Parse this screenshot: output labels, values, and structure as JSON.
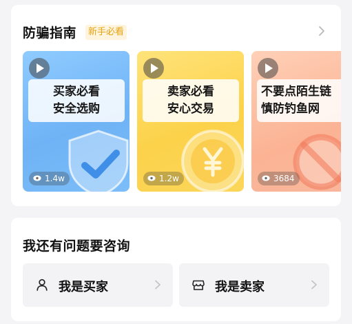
{
  "guide": {
    "title": "防骗指南",
    "badge": "新手必看",
    "chevron_icon": "chevron-right-icon",
    "videos": [
      {
        "lines": [
          "买家必看",
          "安全选购"
        ],
        "views": "1.4w",
        "theme": "blue",
        "art": "shield-check-icon"
      },
      {
        "lines": [
          "卖家必看",
          "安心交易"
        ],
        "views": "1.2w",
        "theme": "yellow",
        "art": "yen-coin-icon"
      },
      {
        "lines": [
          "不要点陌生链",
          "慎防钓鱼网"
        ],
        "views": "3684",
        "theme": "orange",
        "art": "prohibited-link-icon"
      }
    ]
  },
  "consult": {
    "title": "我还有问题要咨询",
    "buyer": {
      "label": "我是买家",
      "icon": "person-icon"
    },
    "seller": {
      "label": "我是卖家",
      "icon": "store-icon"
    }
  },
  "colors": {
    "badge_bg": "#fff4de",
    "badge_text": "#e6a313",
    "card_bg": "#ffffff",
    "page_bg": "#f4f4f6",
    "button_bg": "#f3f3f5"
  }
}
